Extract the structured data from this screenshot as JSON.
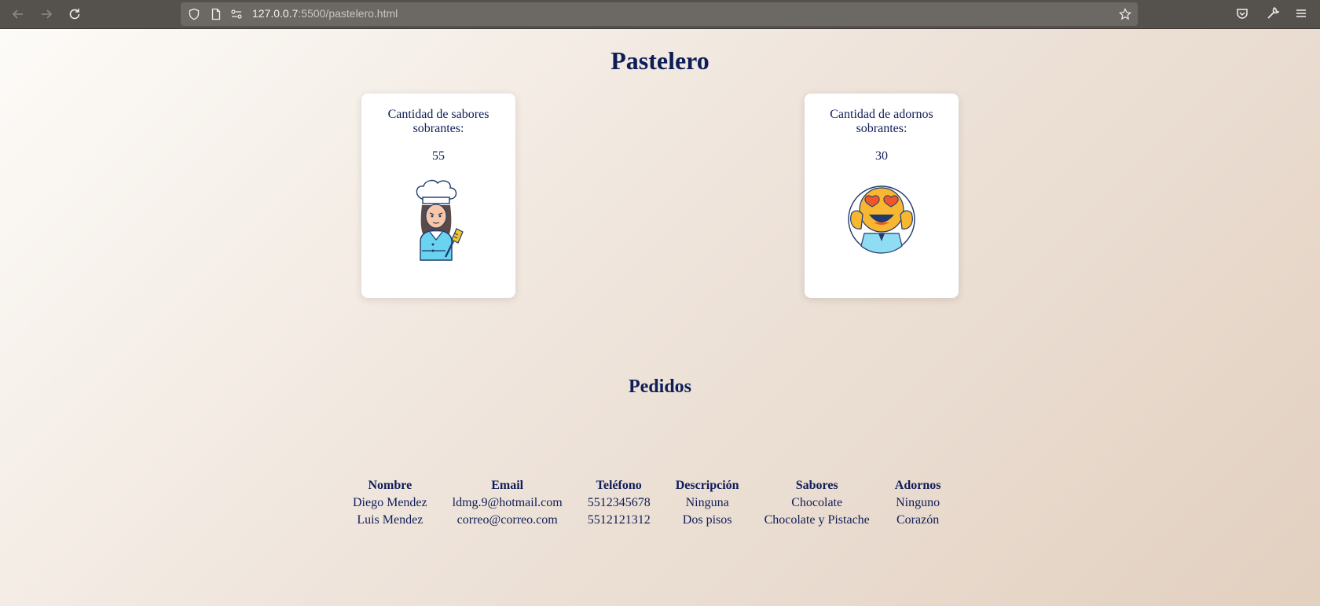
{
  "browser": {
    "url_host": "127.0.0.7",
    "url_path": ":5500/pastelero.html"
  },
  "page": {
    "title": "Pastelero",
    "cards": [
      {
        "label": "Cantidad de sabores sobrantes:",
        "value": "55",
        "illustration": "chef-woman-illustration"
      },
      {
        "label": "Cantidad de adornos sobrantes:",
        "value": "30",
        "illustration": "heart-eyes-emoji-illustration"
      }
    ],
    "orders_title": "Pedidos",
    "table": {
      "headers": [
        "Nombre",
        "Email",
        "Teléfono",
        "Descripción",
        "Sabores",
        "Adornos"
      ],
      "rows": [
        [
          "Diego Mendez",
          "ldmg.9@hotmail.com",
          "5512345678",
          "Ninguna",
          "Chocolate",
          "Ninguno"
        ],
        [
          "Luis Mendez",
          "correo@correo.com",
          "5512121312",
          "Dos pisos",
          "Chocolate y Pistache",
          "Corazón"
        ]
      ]
    }
  }
}
